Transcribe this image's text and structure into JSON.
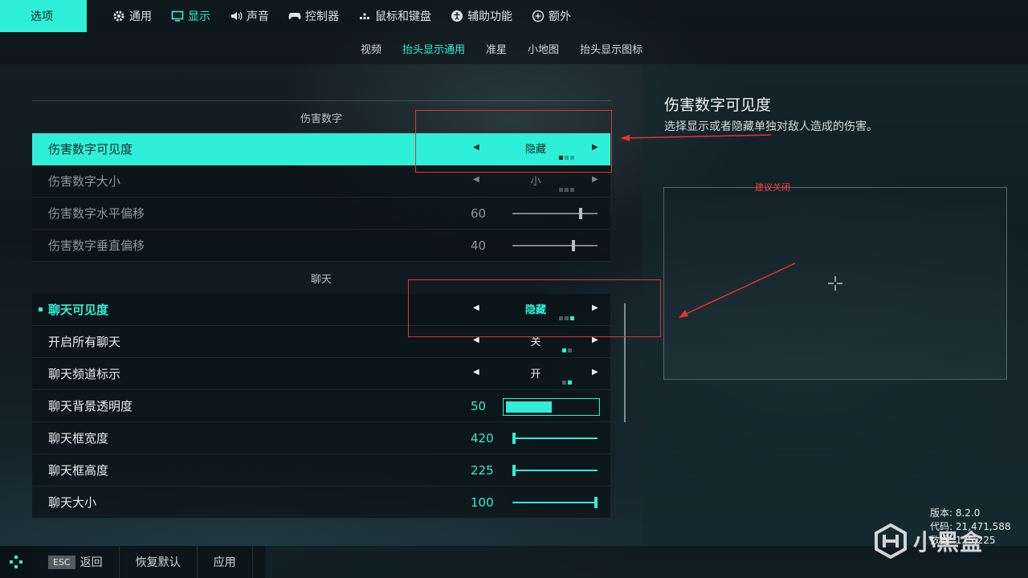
{
  "topbar": {
    "options_label": "选项",
    "nav": [
      {
        "label": "通用",
        "icon": "gear-icon"
      },
      {
        "label": "显示",
        "icon": "monitor-icon",
        "active": true
      },
      {
        "label": "声音",
        "icon": "speaker-icon"
      },
      {
        "label": "控制器",
        "icon": "gamepad-icon"
      },
      {
        "label": "鼠标和键盘",
        "icon": "keyboard-icon"
      },
      {
        "label": "辅助功能",
        "icon": "accessibility-icon"
      },
      {
        "label": "额外",
        "icon": "plus-circle-icon"
      }
    ]
  },
  "subnav": [
    "视频",
    "抬头显示通用",
    "准星",
    "小地图",
    "抬头显示图标"
  ],
  "subnav_active": "抬头显示通用",
  "sections": {
    "damage": {
      "header": "伤害数字",
      "rows": [
        {
          "label": "伤害数字可见度",
          "value": "隐藏",
          "dots": [
            1,
            0,
            0
          ]
        },
        {
          "label": "伤害数字大小",
          "value": "小",
          "dots": [
            0,
            0,
            0
          ]
        },
        {
          "label": "伤害数字水平偏移",
          "value": "60",
          "level": 0.8
        },
        {
          "label": "伤害数字垂直偏移",
          "value": "40",
          "level": 0.72
        }
      ]
    },
    "chat": {
      "header": "聊天",
      "rows": [
        {
          "label": "聊天可见度",
          "value": "隐藏",
          "dots": [
            0,
            0,
            1
          ]
        },
        {
          "label": "开启所有聊天",
          "value": "关",
          "dots": [
            1,
            0
          ]
        },
        {
          "label": "聊天频道标示",
          "value": "开",
          "dots": [
            0,
            1
          ]
        },
        {
          "label": "聊天背景透明度",
          "value": "50",
          "level": 0.5
        },
        {
          "label": "聊天框宽度",
          "value": "420",
          "level": 0.0
        },
        {
          "label": "聊天框高度",
          "value": "225",
          "level": 0.0
        },
        {
          "label": "聊天大小",
          "value": "100",
          "level": 1.0
        }
      ]
    }
  },
  "info": {
    "title": "伤害数字可见度",
    "description": "选择显示或者隐藏单独对敌人造成的伤害。",
    "note": "建议关闭"
  },
  "footer": {
    "esc_key": "ESC",
    "back": "返回",
    "reset": "恢复默认",
    "apply": "应用"
  },
  "version": {
    "line1": "版本: 8.2.0",
    "line2": "代码: 21,471,588",
    "line3": "数据: 125,225"
  },
  "watermark": "小黑盒",
  "colors": {
    "accent": "#2ef0d8",
    "annotation": "#e8322a"
  }
}
